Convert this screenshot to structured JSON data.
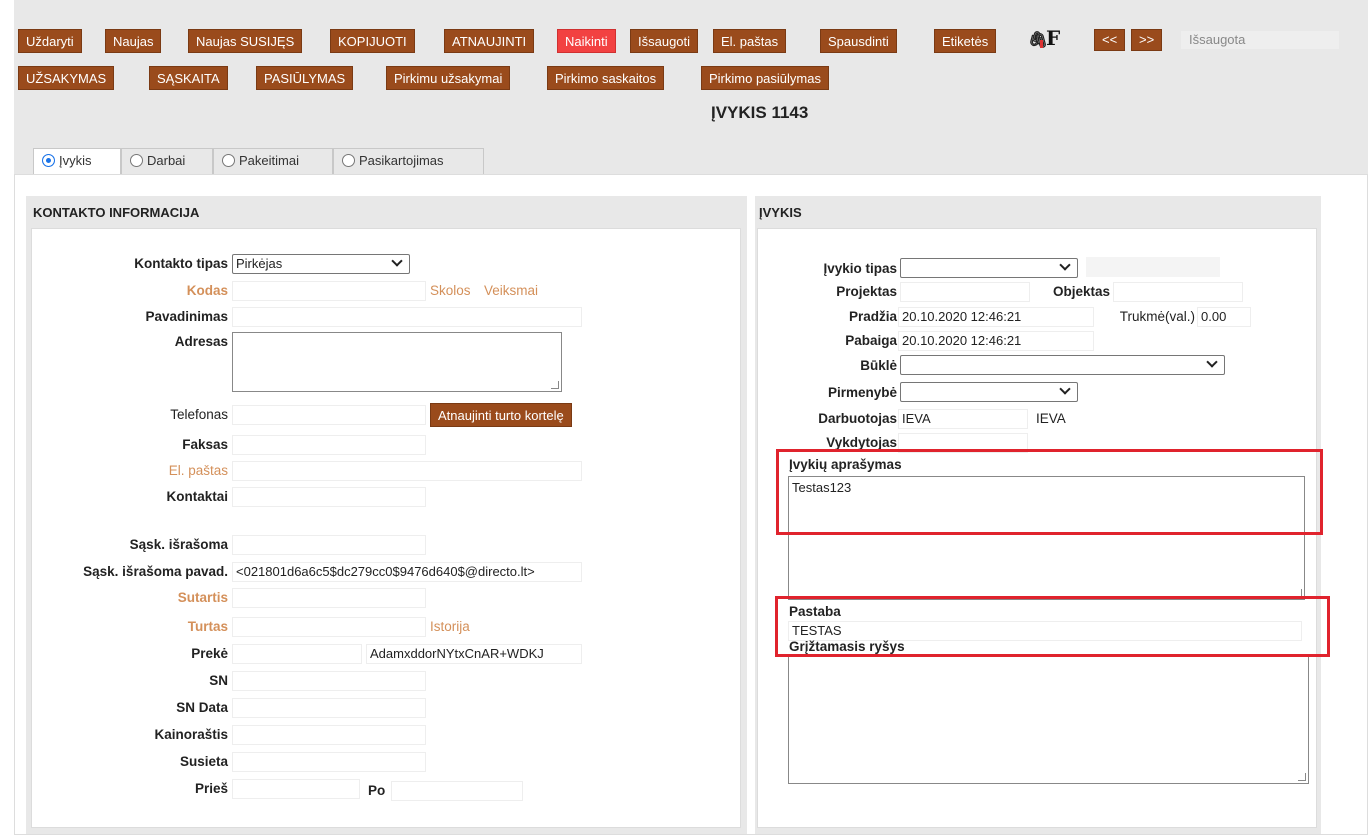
{
  "toolbar": {
    "row1": [
      "Uždaryti",
      "Naujas",
      "Naujas SUSIJĘS",
      "KOPIJUOTI",
      "ATNAUJINTI",
      "Naikinti",
      "Išsaugoti",
      "El. paštas",
      "Spausdinti",
      "Etiketės"
    ],
    "nav_prev": "<<",
    "nav_next": ">>",
    "status": "Išsaugota",
    "row2": [
      "UŽSAKYMAS",
      "SĄSKAITA",
      "PASIŪLYMAS",
      "Pirkimu užsakymai",
      "Pirkimo saskaitos",
      "Pirkimo pasiūlymas"
    ],
    "f_icon_letter": "F"
  },
  "page_title": "ĮVYKIS 1143",
  "tabs": [
    "Įvykis",
    "Darbai",
    "Pakeitimai",
    "Pasikartojimas"
  ],
  "contact": {
    "title": "KONTAKTO INFORMACIJA",
    "kontakto_tipas_label": "Kontakto tipas",
    "kontakto_tipas_value": "Pirkėjas",
    "kodas_label": "Kodas",
    "skolos": "Skolos",
    "veiksmai": "Veiksmai",
    "pavadinimas_label": "Pavadinimas",
    "adresas_label": "Adresas",
    "telefonas_label": "Telefonas",
    "refresh_button": "Atnaujinti turto kortelę",
    "faksas_label": "Faksas",
    "el_pastas_label": "El. paštas",
    "kontaktai_label": "Kontaktai",
    "sask_israsoma_label": "Sąsk. išrašoma",
    "sask_israsoma_pavad_label": "Sąsk. išrašoma pavad.",
    "sask_israsoma_pavad_value": "<021801d6a6c5$dc279cc0$9476d640$@directo.lt>",
    "sutartis_label": "Sutartis",
    "turtas_label": "Turtas",
    "istorija": "Istorija",
    "preke_label": "Prekė",
    "preke_value": "AdamxddorNYtxCnAR+WDKJ",
    "sn_label": "SN",
    "sn_data_label": "SN Data",
    "kainorastis_label": "Kainoraštis",
    "susieta_label": "Susieta",
    "pries_label": "Prieš",
    "po_label": "Po"
  },
  "event": {
    "title": "ĮVYKIS",
    "ivykio_tipas_label": "Įvykio tipas",
    "projektas_label": "Projektas",
    "objektas_label": "Objektas",
    "pradzia_label": "Pradžia",
    "pradzia_value": "20.10.2020 12:46:21",
    "trukme_label": "Trukmė(val.)",
    "trukme_value": "0.00",
    "pabaiga_label": "Pabaiga",
    "pabaiga_value": "20.10.2020 12:46:21",
    "bukle_label": "Būklė",
    "pirmenybe_label": "Pirmenybė",
    "darbuotojas_label": "Darbuotojas",
    "darbuotojas_value": "IEVA",
    "darbuotojas_name": "IEVA",
    "vykdytojas_label": "Vykdytojas",
    "aprasymas_label": "Įvykių aprašymas",
    "aprasymas_value": "Testas123",
    "pastaba_label": "Pastaba",
    "pastaba_value": "TESTAS",
    "griztamasis_label": "Grįžtamasis ryšys"
  }
}
